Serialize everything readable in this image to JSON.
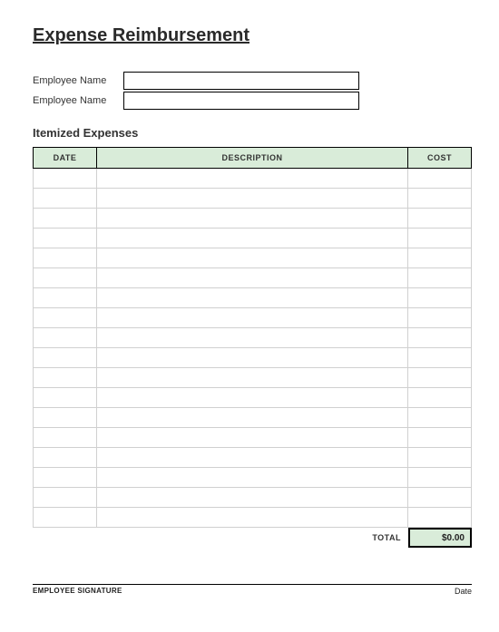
{
  "title": "Expense Reimbursement",
  "meta": {
    "label1": "Employee Name",
    "value1": "",
    "label2": "Employee Name",
    "value2": ""
  },
  "section_title": "Itemized Expenses",
  "headers": {
    "date": "DATE",
    "description": "DESCRIPTION",
    "cost": "COST"
  },
  "rows": [
    {
      "date": "",
      "description": "",
      "cost": ""
    },
    {
      "date": "",
      "description": "",
      "cost": ""
    },
    {
      "date": "",
      "description": "",
      "cost": ""
    },
    {
      "date": "",
      "description": "",
      "cost": ""
    },
    {
      "date": "",
      "description": "",
      "cost": ""
    },
    {
      "date": "",
      "description": "",
      "cost": ""
    },
    {
      "date": "",
      "description": "",
      "cost": ""
    },
    {
      "date": "",
      "description": "",
      "cost": ""
    },
    {
      "date": "",
      "description": "",
      "cost": ""
    },
    {
      "date": "",
      "description": "",
      "cost": ""
    },
    {
      "date": "",
      "description": "",
      "cost": ""
    },
    {
      "date": "",
      "description": "",
      "cost": ""
    },
    {
      "date": "",
      "description": "",
      "cost": ""
    },
    {
      "date": "",
      "description": "",
      "cost": ""
    },
    {
      "date": "",
      "description": "",
      "cost": ""
    },
    {
      "date": "",
      "description": "",
      "cost": ""
    },
    {
      "date": "",
      "description": "",
      "cost": ""
    },
    {
      "date": "",
      "description": "",
      "cost": ""
    }
  ],
  "total": {
    "label": "TOTAL",
    "value": "$0.00"
  },
  "signature": {
    "label": "EMPLOYEE SIGNATURE",
    "date_label": "Date"
  }
}
